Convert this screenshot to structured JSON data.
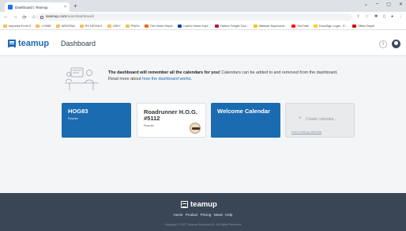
{
  "browser": {
    "tab_title": "Dashboard | Teamup",
    "tab_close": "×",
    "new_tab": "+",
    "window_controls": [
      "⌄",
      "–",
      "▢",
      "✕"
    ],
    "nav_icons": [
      "←",
      "→",
      "⟳",
      "⌂"
    ],
    "url_host": "teamup.com",
    "url_path": "/user/dashboard",
    "toolbar_icons": [
      "share-icon",
      "star-icon",
      "extension-icon",
      "sidebar-icon",
      "profile-icon",
      "menu-icon"
    ],
    "bookmarks": [
      "Imported From E",
      "LYNNE",
      "ARIZONA",
      "RV DETAILS",
      "JODY",
      "PNG's",
      "The Home Depot",
      "Lowe's Home Impr...",
      "Harbor Freight Tool...",
      "Walmart Supercent...",
      "YouTube",
      "DocuSign Login - E...",
      "Office Depot"
    ]
  },
  "header": {
    "brand": "teamup",
    "page_title": "Dashboard",
    "info_icon": "i"
  },
  "notice": {
    "bold": "The dashboard will remember all the calendars for you!",
    "text": " Calendars can be added to and removed from the dashboard.",
    "line2_prefix": "Read more about ",
    "link": "how the dashboard works",
    "line2_suffix": "."
  },
  "calendars": [
    {
      "name": "HOG83",
      "role": "Reader"
    },
    {
      "name": "Roadrunner H.O.G. #5112",
      "role": "Reader"
    },
    {
      "name": "Welcome Calendar",
      "role": ""
    }
  ],
  "create": {
    "plus": "+",
    "label": "Create calendar...",
    "add_existing": "Add existing calendar"
  },
  "footer": {
    "brand": "teamup",
    "links": [
      "Home",
      "Product",
      "Pricing",
      "News",
      "Help"
    ],
    "copyright": "Copyright © 2022 Teamup Solutions AG. All Rights Reserved."
  },
  "colors": {
    "brand_blue": "#1b6bb0",
    "footer_bg": "#3a4656",
    "page_bg": "#f4f5f7"
  }
}
